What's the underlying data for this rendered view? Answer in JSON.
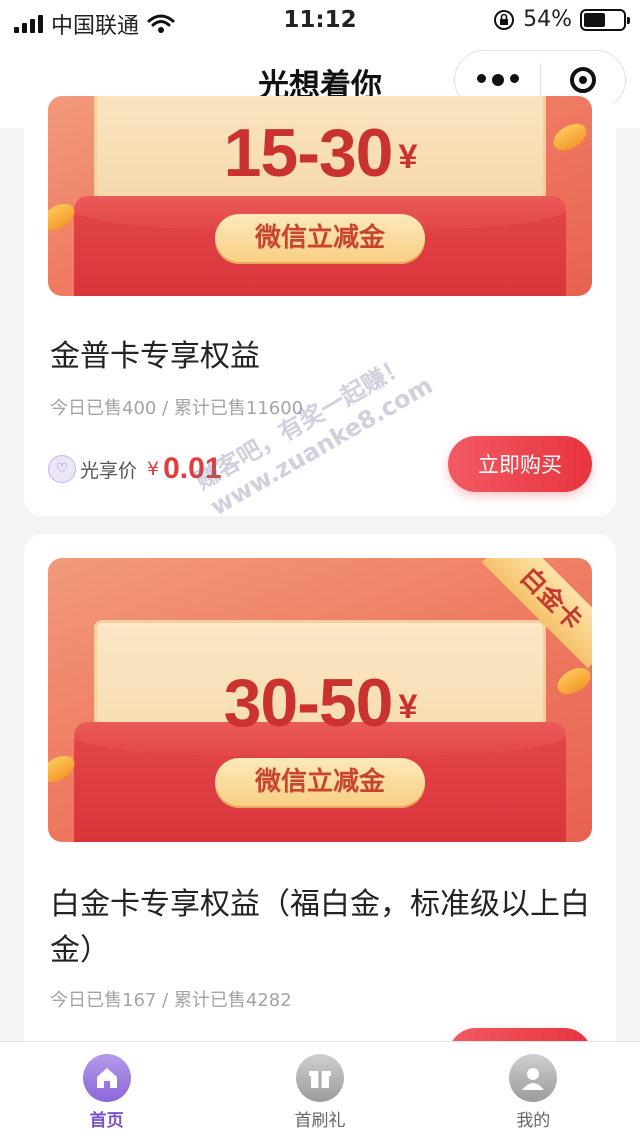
{
  "status_bar": {
    "carrier": "中国联通",
    "time": "11:12",
    "battery_percent": "54%",
    "battery_level": 0.54
  },
  "nav": {
    "title": "光想着你",
    "more_icon": "more-dots-icon",
    "close_icon": "target-close-icon"
  },
  "cards": [
    {
      "amount": "15-30",
      "currency": "¥",
      "pill_text": "微信立减金",
      "title": "金普卡专享权益",
      "sales": "今日已售400 / 累计已售11600",
      "price_label": "光享价",
      "price_currency": "¥",
      "price": "0.01",
      "buy_label": "立即购买"
    },
    {
      "amount": "30-50",
      "currency": "¥",
      "pill_text": "微信立减金",
      "ribbon": "白金卡",
      "title": "白金卡专享权益（福白金，标准级以上白金）",
      "sales": "今日已售167 / 累计已售4282"
    }
  ],
  "watermark": {
    "line1": "赚客吧，有奖一起赚！",
    "line2": "www.zuanke8.com"
  },
  "tabbar": [
    {
      "label": "首页",
      "icon": "home-icon",
      "active": true
    },
    {
      "label": "首刷礼",
      "icon": "gift-icon",
      "active": false
    },
    {
      "label": "我的",
      "icon": "user-icon",
      "active": false
    }
  ],
  "colors": {
    "accent_purple": "#8c66da",
    "price_red": "#e23d3d",
    "buy_button": "#e8343f"
  }
}
